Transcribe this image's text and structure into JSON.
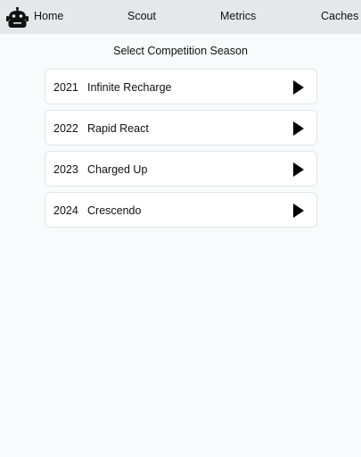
{
  "nav": {
    "logo_icon": "robot-icon",
    "links": [
      {
        "label": "Home"
      },
      {
        "label": "Scout"
      },
      {
        "label": "Metrics"
      },
      {
        "label": "Caches"
      }
    ]
  },
  "main": {
    "heading": "Select Competition Season",
    "seasons": [
      {
        "year": "2021",
        "name": "Infinite Recharge",
        "icon": "play-icon"
      },
      {
        "year": "2022",
        "name": "Rapid React",
        "icon": "play-icon"
      },
      {
        "year": "2023",
        "name": "Charged Up",
        "icon": "play-icon"
      },
      {
        "year": "2024",
        "name": "Crescendo",
        "icon": "play-icon"
      }
    ]
  }
}
